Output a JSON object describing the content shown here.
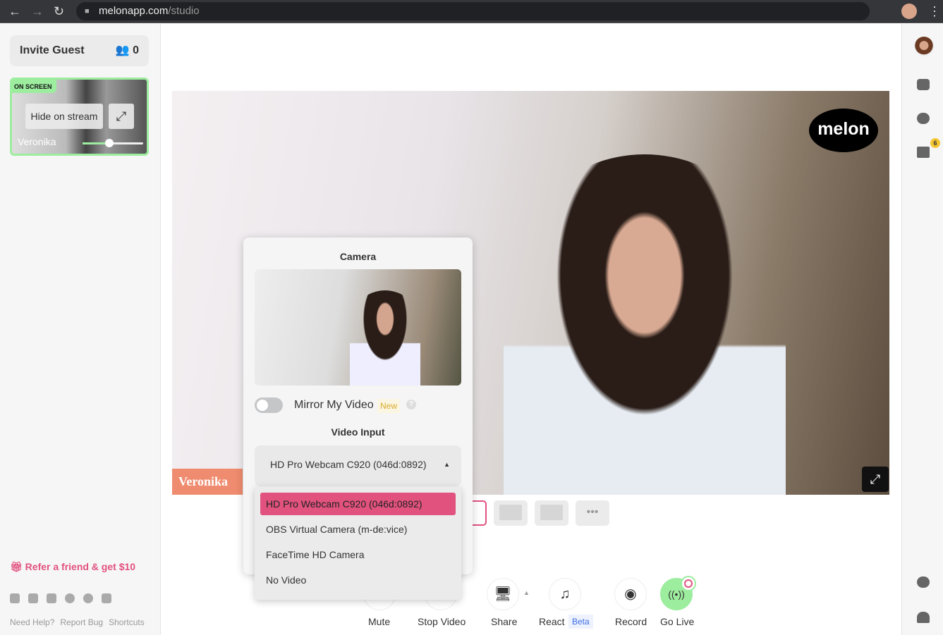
{
  "browser": {
    "url_host": "melonapp.com",
    "url_path": "/studio"
  },
  "sidebar": {
    "invite_label": "Invite Guest",
    "guest_count": "0",
    "tile": {
      "badge": "ON SCREEN",
      "hide_label": "Hide on stream",
      "name": "Veronika",
      "volume_percent": 40
    },
    "refer": "Refer a friend & get $10",
    "social": [
      "twitter-icon",
      "youtube-icon",
      "instagram-icon",
      "facebook-icon",
      "reddit-icon",
      "linkedin-icon"
    ],
    "footer": [
      "Need Help?",
      "Report Bug",
      "Shortcuts"
    ]
  },
  "rail": {
    "calendar_badge": "6"
  },
  "stage": {
    "logo": "melon",
    "name_banner": "Veronika"
  },
  "camera_popup": {
    "title": "Camera",
    "mirror_label": "Mirror My Video",
    "mirror_on": false,
    "new_badge": "New",
    "help": "?",
    "video_input_label": "Video Input",
    "selected": "HD Pro Webcam C920 (046d:0892)",
    "options": [
      "HD Pro Webcam C920 (046d:0892)",
      "OBS Virtual Camera (m-de:vice)",
      "FaceTime HD Camera",
      "No Video"
    ]
  },
  "toolbar": {
    "mute": "Mute",
    "stop_video": "Stop Video",
    "share": "Share",
    "react": "React",
    "beta": "Beta",
    "record": "Record",
    "go_live": "Go Live"
  },
  "colors": {
    "accent_pink": "#e2527f",
    "on_screen_green": "#9ded9f",
    "name_banner": "#ef8b6e"
  }
}
